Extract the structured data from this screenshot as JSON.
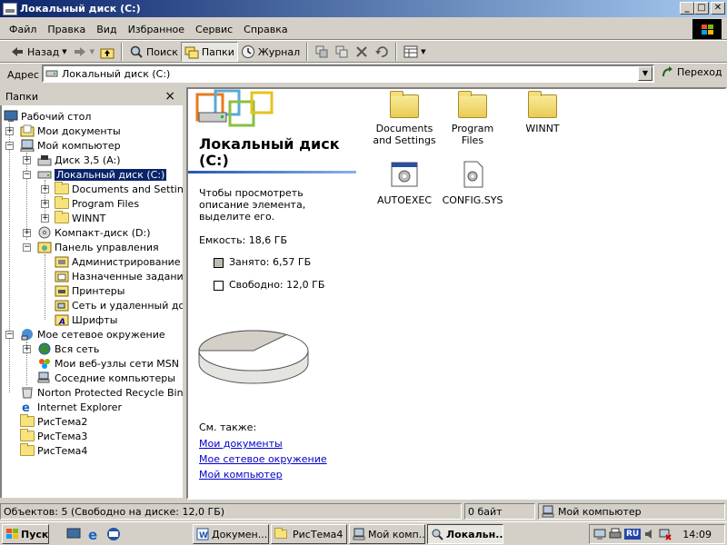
{
  "window": {
    "title": "Локальный диск (C:)",
    "buttons": {
      "minimize": "_",
      "maximize": "□",
      "close": "✕"
    }
  },
  "menu": [
    "Файл",
    "Правка",
    "Вид",
    "Избранное",
    "Сервис",
    "Справка"
  ],
  "toolbar": {
    "back": "Назад",
    "search": "Поиск",
    "folders": "Папки",
    "history": "Журнал"
  },
  "address": {
    "label": "Адрес",
    "value": "Локальный диск (C:)",
    "go": "Переход"
  },
  "folders_panel": {
    "title": "Папки",
    "close": "×",
    "items": [
      {
        "label": "Рабочий стол",
        "icon": "desktop-icon"
      },
      {
        "label": "Мои документы",
        "icon": "my-documents-icon"
      },
      {
        "label": "Мой компьютер",
        "icon": "my-computer-icon"
      },
      {
        "label": "Диск 3,5 (A:)",
        "icon": "floppy-icon"
      },
      {
        "label": "Локальный диск (C:)",
        "icon": "hard-drive-icon",
        "selected": true
      },
      {
        "label": "Documents and Settings",
        "icon": "folder-icon"
      },
      {
        "label": "Program Files",
        "icon": "folder-icon"
      },
      {
        "label": "WINNT",
        "icon": "folder-icon"
      },
      {
        "label": "Компакт-диск (D:)",
        "icon": "cd-drive-icon"
      },
      {
        "label": "Панель управления",
        "icon": "control-panel-icon"
      },
      {
        "label": "Администрирование",
        "icon": "admin-tools-icon"
      },
      {
        "label": "Назначенные задания",
        "icon": "scheduled-tasks-icon"
      },
      {
        "label": "Принтеры",
        "icon": "printers-icon"
      },
      {
        "label": "Сеть и удаленный дост",
        "icon": "network-connections-icon"
      },
      {
        "label": "Шрифты",
        "icon": "fonts-icon"
      },
      {
        "label": "Мое сетевое окружение",
        "icon": "network-places-icon"
      },
      {
        "label": "Вся сеть",
        "icon": "entire-network-icon"
      },
      {
        "label": "Мои веб-узлы сети MSN",
        "icon": "msn-icon"
      },
      {
        "label": "Соседние компьютеры",
        "icon": "computers-near-me-icon"
      },
      {
        "label": "Norton Protected Recycle Bin",
        "icon": "recycle-bin-icon"
      },
      {
        "label": "Internet Explorer",
        "icon": "ie-icon"
      },
      {
        "label": "РисТема2",
        "icon": "folder-icon"
      },
      {
        "label": "РисТема3",
        "icon": "folder-icon"
      },
      {
        "label": "РисТема4",
        "icon": "folder-icon"
      }
    ]
  },
  "info_pane": {
    "title": "Локальный диск (C:)",
    "hint": "Чтобы просмотреть описание элемента, выделите его.",
    "capacity": "Емкость: 18,6 ГБ",
    "used": "Занято: 6,57 ГБ",
    "free": "Свободно: 12,0 ГБ",
    "used_fraction": 0.353,
    "see_also": "См. также:",
    "links": [
      "Мои документы",
      "Мое сетевое окружение",
      "Мой компьютер"
    ]
  },
  "files": [
    {
      "name": "Documents and Settings",
      "type": "folder"
    },
    {
      "name": "Program Files",
      "type": "folder"
    },
    {
      "name": "WINNT",
      "type": "folder"
    },
    {
      "name": "AUTOEXEC",
      "type": "batch"
    },
    {
      "name": "CONFIG.SYS",
      "type": "system"
    }
  ],
  "status": {
    "objects": "Объектов: 5 (Свободно на диске: 12,0 ГБ)",
    "size": "0 байт",
    "location": "Мой компьютер"
  },
  "taskbar": {
    "start": "Пуск",
    "tasks": [
      "Докумен...",
      "РисТема4",
      "Мой комп...",
      "Локальн..."
    ],
    "lang": "RU",
    "clock": "14:09"
  },
  "colors": {
    "selection": "#0a246a",
    "link": "#0000cc",
    "face": "#d4d0c8"
  }
}
